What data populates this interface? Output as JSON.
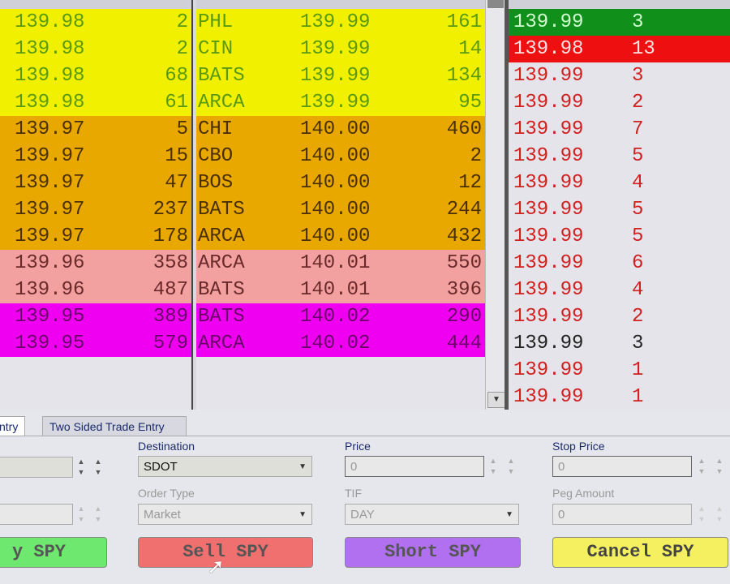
{
  "colors": {
    "yellow": "#f0f000",
    "orange": "#e8a800",
    "pink": "#f2a0a0",
    "magenta": "#f000f0",
    "green": "#10901a",
    "red": "#ee1010"
  },
  "bid_rows": [
    {
      "price": "139.98",
      "size": "2",
      "tier": "yellow"
    },
    {
      "price": "139.98",
      "size": "2",
      "tier": "yellow"
    },
    {
      "price": "139.98",
      "size": "68",
      "tier": "yellow"
    },
    {
      "price": "139.98",
      "size": "61",
      "tier": "yellow"
    },
    {
      "price": "139.97",
      "size": "5",
      "tier": "orange"
    },
    {
      "price": "139.97",
      "size": "15",
      "tier": "orange"
    },
    {
      "price": "139.97",
      "size": "47",
      "tier": "orange"
    },
    {
      "price": "139.97",
      "size": "237",
      "tier": "orange"
    },
    {
      "price": "139.97",
      "size": "178",
      "tier": "orange"
    },
    {
      "price": "139.96",
      "size": "358",
      "tier": "pink"
    },
    {
      "price": "139.96",
      "size": "487",
      "tier": "pink"
    },
    {
      "price": "139.95",
      "size": "389",
      "tier": "magenta"
    },
    {
      "price": "139.95",
      "size": "579",
      "tier": "magenta"
    }
  ],
  "ask_rows": [
    {
      "mmid": "PHL",
      "price": "139.99",
      "size": "161",
      "tier": "yellow"
    },
    {
      "mmid": "CIN",
      "price": "139.99",
      "size": "14",
      "tier": "yellow"
    },
    {
      "mmid": "BATS",
      "price": "139.99",
      "size": "134",
      "tier": "yellow"
    },
    {
      "mmid": "ARCA",
      "price": "139.99",
      "size": "95",
      "tier": "yellow"
    },
    {
      "mmid": "CHI",
      "price": "140.00",
      "size": "460",
      "tier": "orange"
    },
    {
      "mmid": "CBO",
      "price": "140.00",
      "size": "2",
      "tier": "orange"
    },
    {
      "mmid": "BOS",
      "price": "140.00",
      "size": "12",
      "tier": "orange"
    },
    {
      "mmid": "BATS",
      "price": "140.00",
      "size": "244",
      "tier": "orange"
    },
    {
      "mmid": "ARCA",
      "price": "140.00",
      "size": "432",
      "tier": "orange"
    },
    {
      "mmid": "ARCA",
      "price": "140.01",
      "size": "550",
      "tier": "pink"
    },
    {
      "mmid": "BATS",
      "price": "140.01",
      "size": "396",
      "tier": "pink"
    },
    {
      "mmid": "BATS",
      "price": "140.02",
      "size": "290",
      "tier": "magenta"
    },
    {
      "mmid": "ARCA",
      "price": "140.02",
      "size": "444",
      "tier": "magenta"
    }
  ],
  "trades": [
    {
      "price": "139.99",
      "size": "3",
      "style": "green"
    },
    {
      "price": "139.98",
      "size": "13",
      "style": "red"
    },
    {
      "price": "139.99",
      "size": "3",
      "style": "redtext"
    },
    {
      "price": "139.99",
      "size": "2",
      "style": "redtext"
    },
    {
      "price": "139.99",
      "size": "7",
      "style": "redtext"
    },
    {
      "price": "139.99",
      "size": "5",
      "style": "redtext"
    },
    {
      "price": "139.99",
      "size": "4",
      "style": "redtext"
    },
    {
      "price": "139.99",
      "size": "5",
      "style": "redtext"
    },
    {
      "price": "139.99",
      "size": "5",
      "style": "redtext"
    },
    {
      "price": "139.99",
      "size": "6",
      "style": "redtext"
    },
    {
      "price": "139.99",
      "size": "4",
      "style": "redtext"
    },
    {
      "price": "139.99",
      "size": "2",
      "style": "redtext"
    },
    {
      "price": "139.99",
      "size": "3",
      "style": "black"
    },
    {
      "price": "139.99",
      "size": "1",
      "style": "redtext"
    },
    {
      "price": "139.99",
      "size": "1",
      "style": "redtext"
    }
  ],
  "tabs": {
    "entry": "ntry",
    "two_sided": "Two Sided Trade Entry"
  },
  "form": {
    "destination_label": "Destination",
    "destination_value": "SDOT",
    "price_label": "Price",
    "price_value": "0",
    "stop_price_label": "Stop Price",
    "stop_price_value": "0",
    "order_type_label": "Order Type",
    "order_type_value": "Market",
    "tif_label": "TIF",
    "tif_value": "DAY",
    "peg_amount_label": "Peg Amount",
    "peg_amount_value": "0"
  },
  "buttons": {
    "buy": "y SPY",
    "sell": "Sell SPY",
    "short": "Short SPY",
    "cancel": "Cancel SPY"
  }
}
